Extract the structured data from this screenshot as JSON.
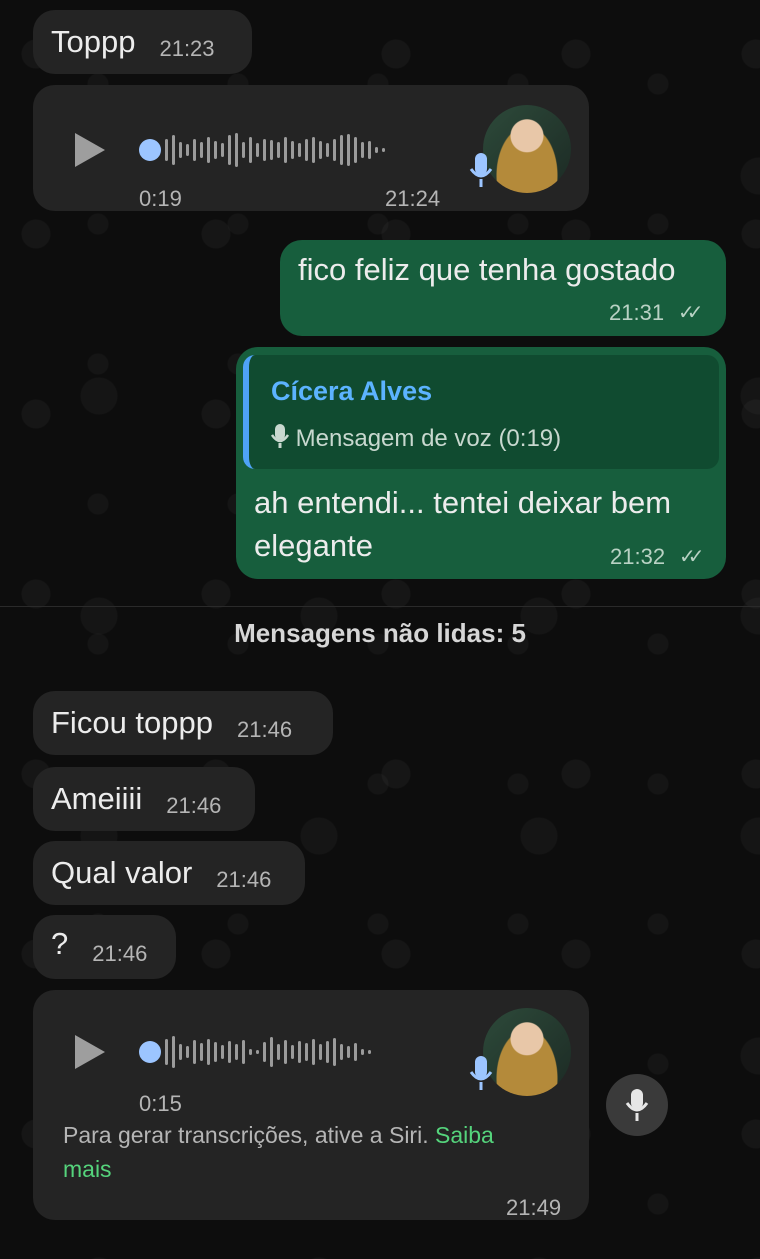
{
  "messages": [
    {
      "type": "text",
      "dir": "in",
      "text": "Toppp",
      "time": "21:23"
    },
    {
      "type": "voice",
      "dir": "in",
      "duration": "0:19",
      "time": "21:24"
    },
    {
      "type": "text",
      "dir": "out",
      "text": "fico feliz que tenha gostado",
      "time": "21:31",
      "status": "read"
    },
    {
      "type": "reply",
      "dir": "out",
      "quote_name": "Cícera Alves",
      "quote_text": "Mensagem de voz (0:19)",
      "text_line1": "ah entendi... tentei deixar bem",
      "text_line2": "elegante",
      "time": "21:32",
      "status": "read"
    },
    {
      "type": "text",
      "dir": "in",
      "text": "Ficou toppp",
      "time": "21:46"
    },
    {
      "type": "text",
      "dir": "in",
      "text": "Ameiiii",
      "time": "21:46"
    },
    {
      "type": "text",
      "dir": "in",
      "text": "Qual valor",
      "time": "21:46"
    },
    {
      "type": "text",
      "dir": "in",
      "text": "?",
      "time": "21:46"
    },
    {
      "type": "voice",
      "dir": "in",
      "duration": "0:15",
      "time": "21:49",
      "transcription_note": "Para gerar transcrições, ative a Siri.",
      "transcription_link": "Saiba mais",
      "link_line1": "Saiba",
      "link_line2": "mais"
    }
  ],
  "unread_divider": "Mensagens não lidas: 5",
  "read_ticks": "✓✓",
  "icons": {
    "play": "play-icon",
    "mic": "microphone-icon",
    "avatar": "contact-avatar"
  },
  "colors": {
    "incoming": "#242424",
    "outgoing": "#175e3d",
    "link": "#55d47c",
    "quote_name": "#5cb3ff",
    "voice_dot": "#9cc5ff"
  }
}
